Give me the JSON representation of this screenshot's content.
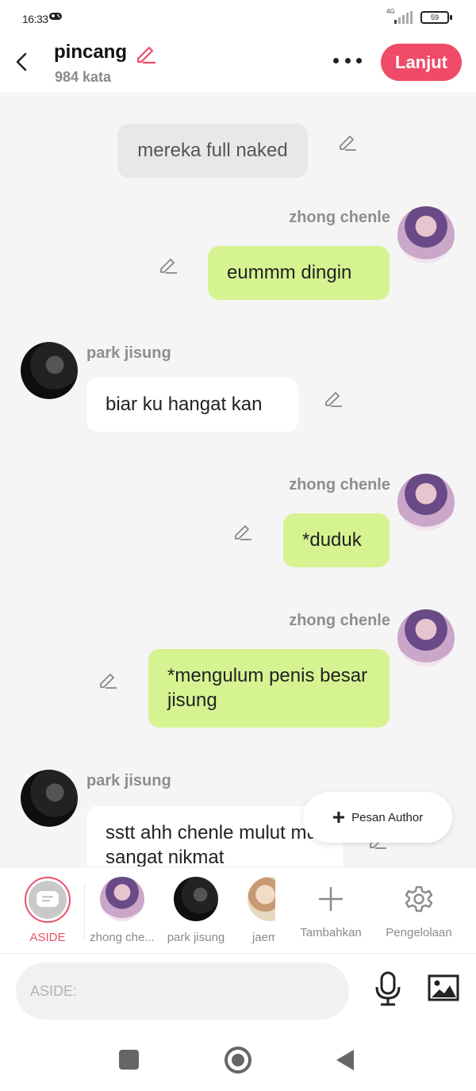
{
  "status": {
    "time": "16:33",
    "network": "4G",
    "battery": "59"
  },
  "header": {
    "title": "pincang",
    "subtitle": "984 kata",
    "next_label": "Lanjut"
  },
  "messages": [
    {
      "type": "narration",
      "text": "mereka full naked"
    },
    {
      "sender": "zhong chenle",
      "side": "right",
      "text": "eummm dingin"
    },
    {
      "sender": "park jisung",
      "side": "left",
      "text": "biar ku hangat kan"
    },
    {
      "sender": "zhong chenle",
      "side": "right",
      "text": "*duduk"
    },
    {
      "sender": "zhong chenle",
      "side": "right",
      "text": "*mengulum penis besar jisung"
    },
    {
      "sender": "park jisung",
      "side": "left",
      "text": "sstt ahh chenle mulut mu sangat nikmat"
    }
  ],
  "fab": {
    "label": "Pesan Author"
  },
  "characters": [
    {
      "label": "ASIDE"
    },
    {
      "label": "zhong che..."
    },
    {
      "label": "park jisung"
    },
    {
      "label": "jaem"
    }
  ],
  "actions": {
    "add_label": "Tambahkan",
    "manage_label": "Pengelolaan"
  },
  "input": {
    "placeholder": "ASIDE:"
  },
  "colors": {
    "accent": "#ef4a67",
    "bubble_green": "#d6f391",
    "narration_bg": "#e8e8e8"
  }
}
